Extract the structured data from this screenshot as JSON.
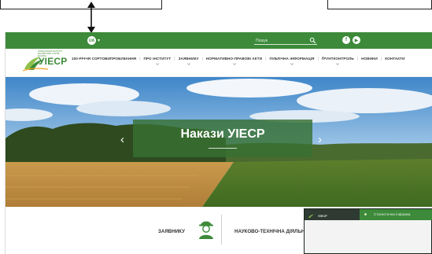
{
  "topbar": {
    "language_label": "UA",
    "search_placeholder": "Пошук",
    "social": [
      "f",
      "▶"
    ],
    "background_color": "#3c8a3a"
  },
  "header": {
    "logo_text": "УІЕСР",
    "logo_tagline": "УКРАЇНСЬКИЙ ІНСТИТУТ ЕКСПЕРТИЗИ СОРТІВ РОСЛИН",
    "nav": [
      {
        "label": "100-РІЧЧЯ СОРТОВИПРОБУВАННЯ",
        "has_dropdown": false
      },
      {
        "label": "ПРО ІНСТИТУТ",
        "has_dropdown": true
      },
      {
        "label": "ЗАЯВНИКУ",
        "has_dropdown": true
      },
      {
        "label": "НОРМАТИВНО-ПРАВОВІ АКТИ",
        "has_dropdown": true
      },
      {
        "label": "ПУБЛІЧНА ІНФОРМАЦІЯ",
        "has_dropdown": true
      },
      {
        "label": "ҐРУНТКОНТРОЛЬ",
        "has_dropdown": true
      },
      {
        "label": "НОВИНИ",
        "has_dropdown": false
      },
      {
        "label": "КОНТАКТИ",
        "has_dropdown": false
      }
    ]
  },
  "hero": {
    "title": "Накази УІЕСР",
    "prev_icon": "chevron-left-icon",
    "next_icon": "chevron-right-icon"
  },
  "sections": {
    "applicants": "ЗАЯВНИКУ",
    "science": "НАУКОВО-ТЕХНІЧНА ДІЯЛЬНІСТЬ"
  },
  "popup": {
    "brand": "УІЕСР",
    "text": "Статистична інформа"
  },
  "colors": {
    "brand_green": "#3c8a3a",
    "panel_green": "#377032"
  }
}
